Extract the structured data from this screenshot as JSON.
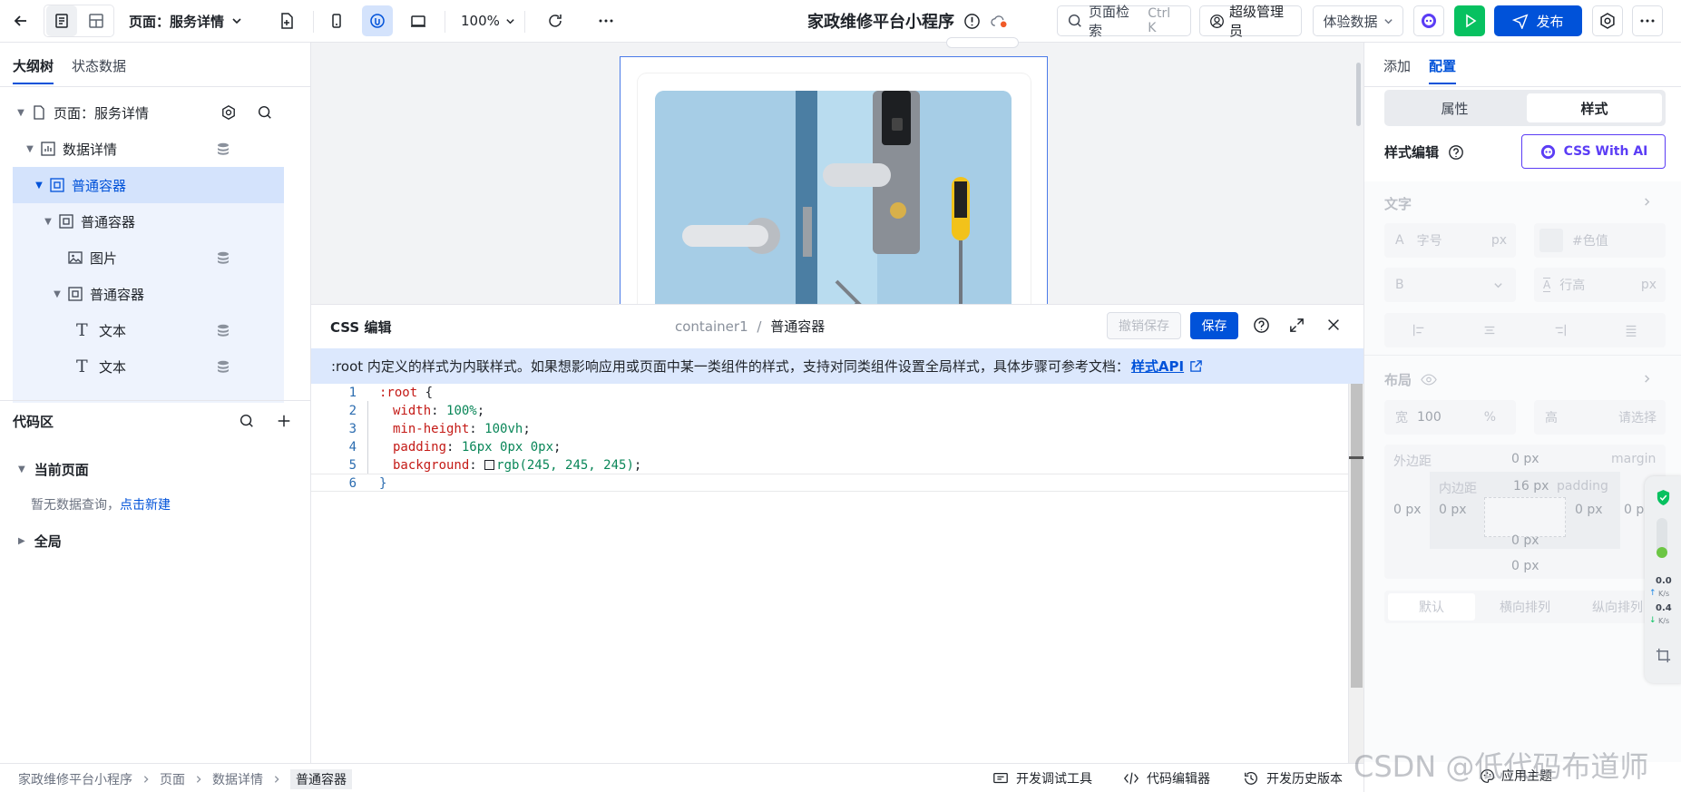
{
  "topbar": {
    "page_select": "页面：服务详情",
    "zoom": "100%",
    "app_title": "家政维修平台小程序",
    "search_label": "页面检索",
    "search_hint": "Ctrl K",
    "user": "超级管理员",
    "data_select": "体验数据",
    "publish": "发布"
  },
  "left": {
    "tabs": [
      "大纲树",
      "状态数据"
    ],
    "tree": [
      {
        "label": "页面：服务详情",
        "icon": "page-icon"
      },
      {
        "label": "数据详情",
        "icon": "data-chart-icon"
      },
      {
        "label": "普通容器",
        "icon": "container-icon",
        "selected": true
      },
      {
        "label": "普通容器",
        "icon": "container-icon"
      },
      {
        "label": "图片",
        "icon": "image-icon"
      },
      {
        "label": "普通容器",
        "icon": "container-icon"
      },
      {
        "label": "文本",
        "icon": "text-icon"
      },
      {
        "label": "文本",
        "icon": "text-icon"
      }
    ],
    "code_area": {
      "title": "代码区",
      "current_page": "当前页面",
      "empty_text": "暂无数据查询，",
      "create_link": "点击新建",
      "global": "全局"
    }
  },
  "css_editor": {
    "title": "CSS 编辑",
    "path": "container1",
    "path_sep": "/",
    "path_name": "普通容器",
    "undo": "撤销保存",
    "save": "保存",
    "notice": ":root 内定义的样式为内联样式。如果想影响应用或页面中某一类组件的样式，支持对同类组件设置全局样式，具体步骤可参考文档：",
    "notice_link": "样式API",
    "lines": [
      {
        "n": "1",
        "sel": ":root",
        "rest": " {"
      },
      {
        "n": "2",
        "prop": "width",
        "val": "100%"
      },
      {
        "n": "3",
        "prop": "min-height",
        "val": "100vh"
      },
      {
        "n": "4",
        "prop": "padding",
        "val": "16px 0px 0px"
      },
      {
        "n": "5",
        "prop": "background",
        "val": "rgb(245, 245, 245)"
      },
      {
        "n": "6",
        "sel": "}",
        "rest": ""
      }
    ]
  },
  "right": {
    "tabs": [
      "添加",
      "配置"
    ],
    "seg": [
      "属性",
      "样式"
    ],
    "style_edit": "样式编辑",
    "ai_button": "CSS With AI",
    "text_section": "文字",
    "font_size_prefix": "A",
    "font_size": "字号",
    "font_unit": "px",
    "color_ph": "#色值",
    "bold_prefix": "B",
    "line_height": "行高",
    "lh_unit": "px",
    "layout_section": "布局",
    "width_label": "宽",
    "width_val": "100",
    "width_unit": "%",
    "height_label": "高",
    "height_ph": "请选择",
    "margin_label": "外边距",
    "margin_top": "0 px",
    "margin_tag": "margin",
    "padding_label": "内边距",
    "padding_top": "16 px",
    "padding_tag": "padding",
    "left_margin": "0 px",
    "left_padding": "0 px",
    "right_padding": "0 px",
    "right_margin": "0 px",
    "bottom_padding": "0 px",
    "bottom_margin": "0 px",
    "dir": [
      "默认",
      "横向排列",
      "纵向排列"
    ],
    "theme": "应用主题",
    "net": {
      "up": "0.0",
      "down": "0.4",
      "unit": "K/s"
    }
  },
  "footer": {
    "crumbs": [
      "家政维修平台小程序",
      "页面",
      "数据详情",
      "普通容器"
    ],
    "tools": [
      "开发调试工具",
      "代码编辑器",
      "开发历史版本"
    ]
  },
  "watermark": "CSDN @低代码布道师",
  "colors": {
    "primary": "#0052d9",
    "selected_bg": "#d4e3fc",
    "notice_bg": "#dce8fd",
    "green": "#07c160"
  }
}
